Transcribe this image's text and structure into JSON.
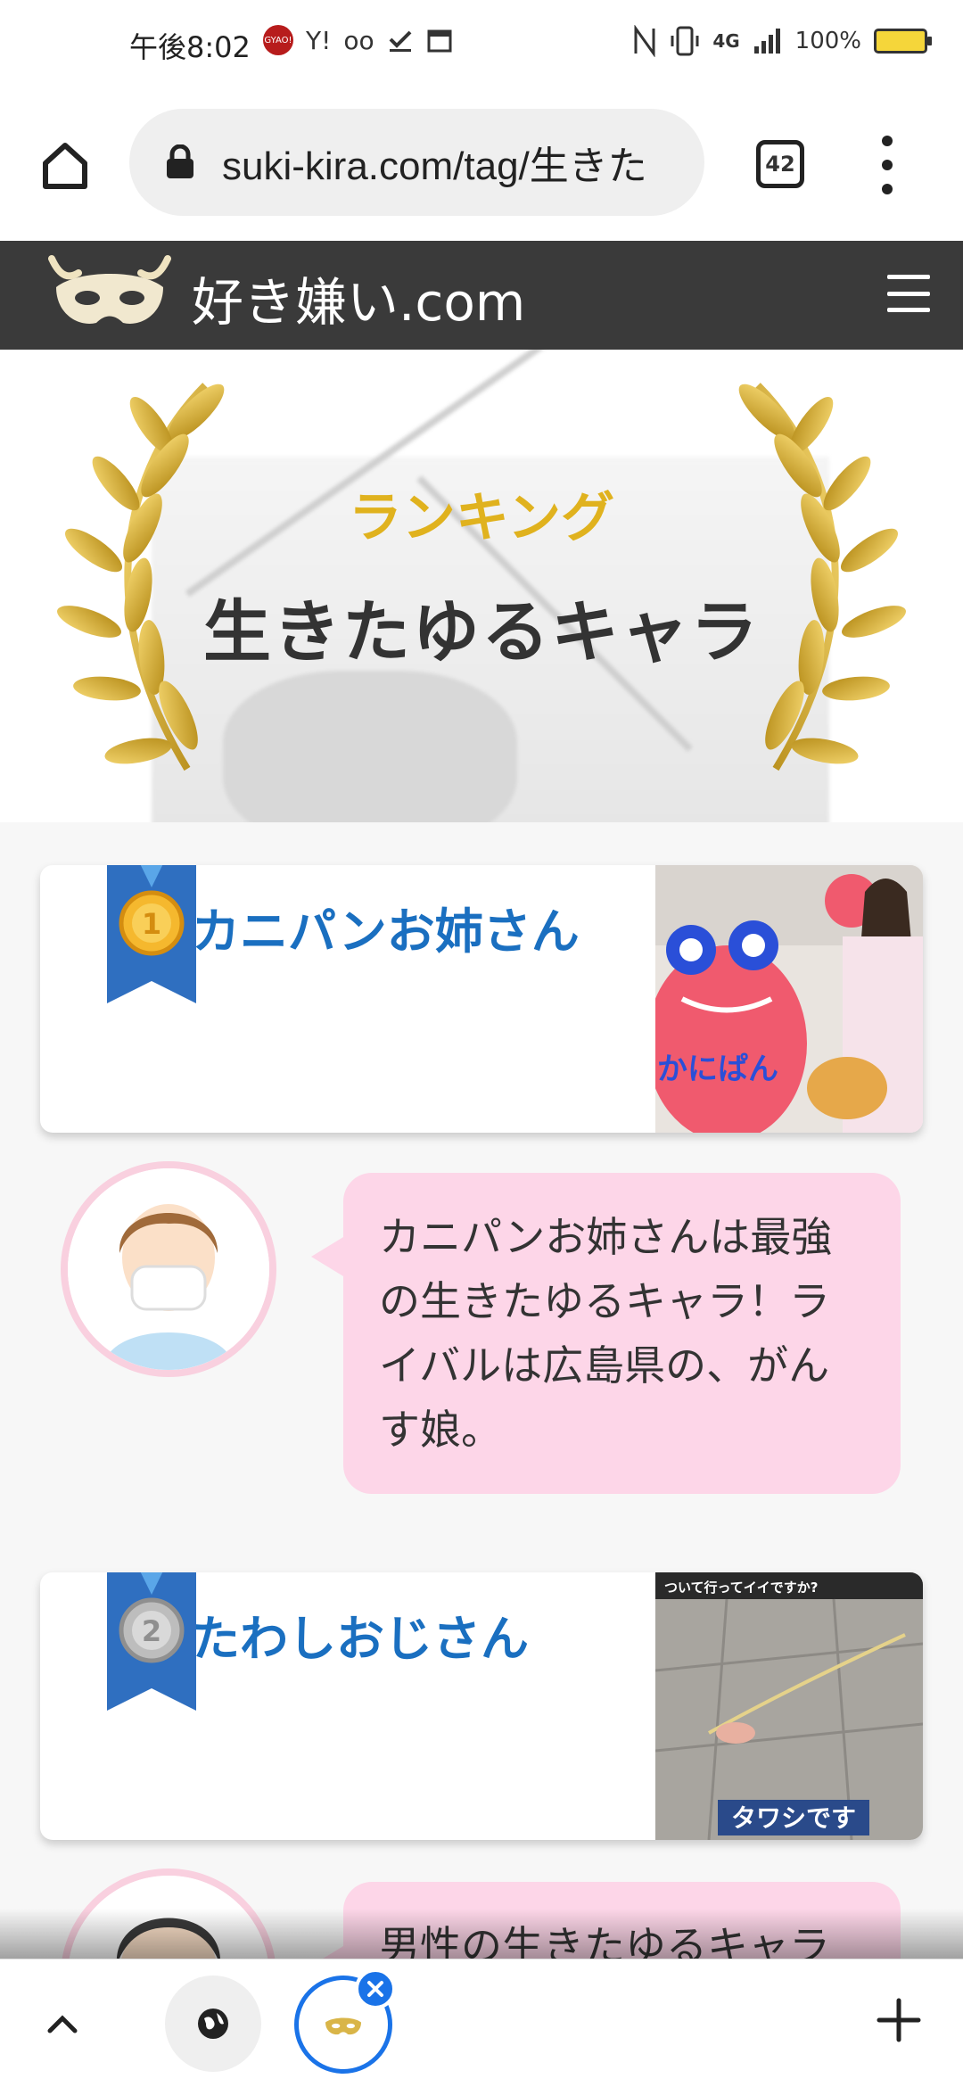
{
  "status_bar": {
    "time": "午後8:02",
    "notification_icons": [
      "gyao-icon",
      "yahoo-icon",
      "voicemail-icon",
      "check-icon",
      "calendar-icon"
    ],
    "gyao_text": "GYAO!",
    "yahoo_text": "Y!",
    "voicemail_glyph": "oo",
    "network": "4G",
    "battery": "100%"
  },
  "browser": {
    "url": "suki-kira.com/tag/生きた",
    "tab_count": "42"
  },
  "site": {
    "name": "好き嫌い.com"
  },
  "hero": {
    "label": "ランキング",
    "title": "生きたゆるキャラ"
  },
  "rankings": [
    {
      "rank": "1",
      "name": "カニパンお姉さん",
      "comment": "カニパンお姉さんは最強の生きたゆるキャラ！ライバルは広島県の、がんす娘。"
    },
    {
      "rank": "2",
      "name": "たわしおじさん",
      "comment": "男性の生きたゆるキャラ"
    }
  ],
  "thumbnails": {
    "rank1_sign": "かにぱん",
    "rank2_caption": "タワシです",
    "rank2_banner": "ついて行ってイイですか?"
  },
  "colors": {
    "site_header": "#3a3a3a",
    "rank_name": "#1a6fc0",
    "ranking_label": "#e0b21e",
    "bubble": "#fdd6e8",
    "medal_ribbon": "#2f6fc0"
  }
}
